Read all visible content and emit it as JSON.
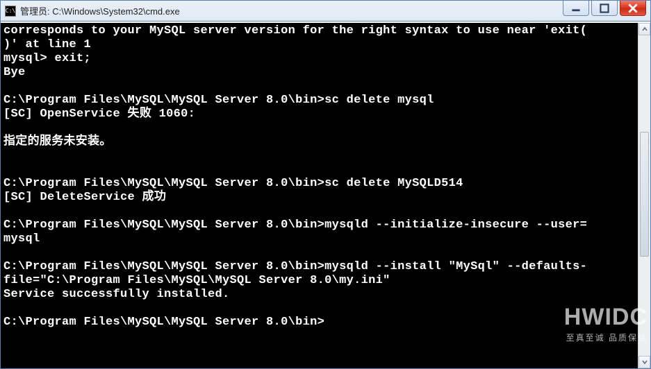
{
  "window": {
    "icon_label": "C:\\",
    "title": "管理员: C:\\Windows\\System32\\cmd.exe"
  },
  "terminal": {
    "lines": [
      "corresponds to your MySQL server version for the right syntax to use near 'exit(",
      ")' at line 1",
      "mysql> exit;",
      "Bye",
      "",
      "C:\\Program Files\\MySQL\\MySQL Server 8.0\\bin>sc delete mysql",
      "[SC] OpenService 失败 1060:",
      "",
      "指定的服务未安装。",
      "",
      "",
      "C:\\Program Files\\MySQL\\MySQL Server 8.0\\bin>sc delete MySQLD514",
      "[SC] DeleteService 成功",
      "",
      "C:\\Program Files\\MySQL\\MySQL Server 8.0\\bin>mysqld --initialize-insecure --user=",
      "mysql",
      "",
      "C:\\Program Files\\MySQL\\MySQL Server 8.0\\bin>mysqld --install \"MySql\" --defaults-",
      "file=\"C:\\Program Files\\MySQL\\MySQL Server 8.0\\my.ini\"",
      "Service successfully installed.",
      "",
      "C:\\Program Files\\MySQL\\MySQL Server 8.0\\bin>"
    ]
  },
  "watermark": {
    "big": "HWIDC",
    "small": "至真至诚 品质保信"
  }
}
